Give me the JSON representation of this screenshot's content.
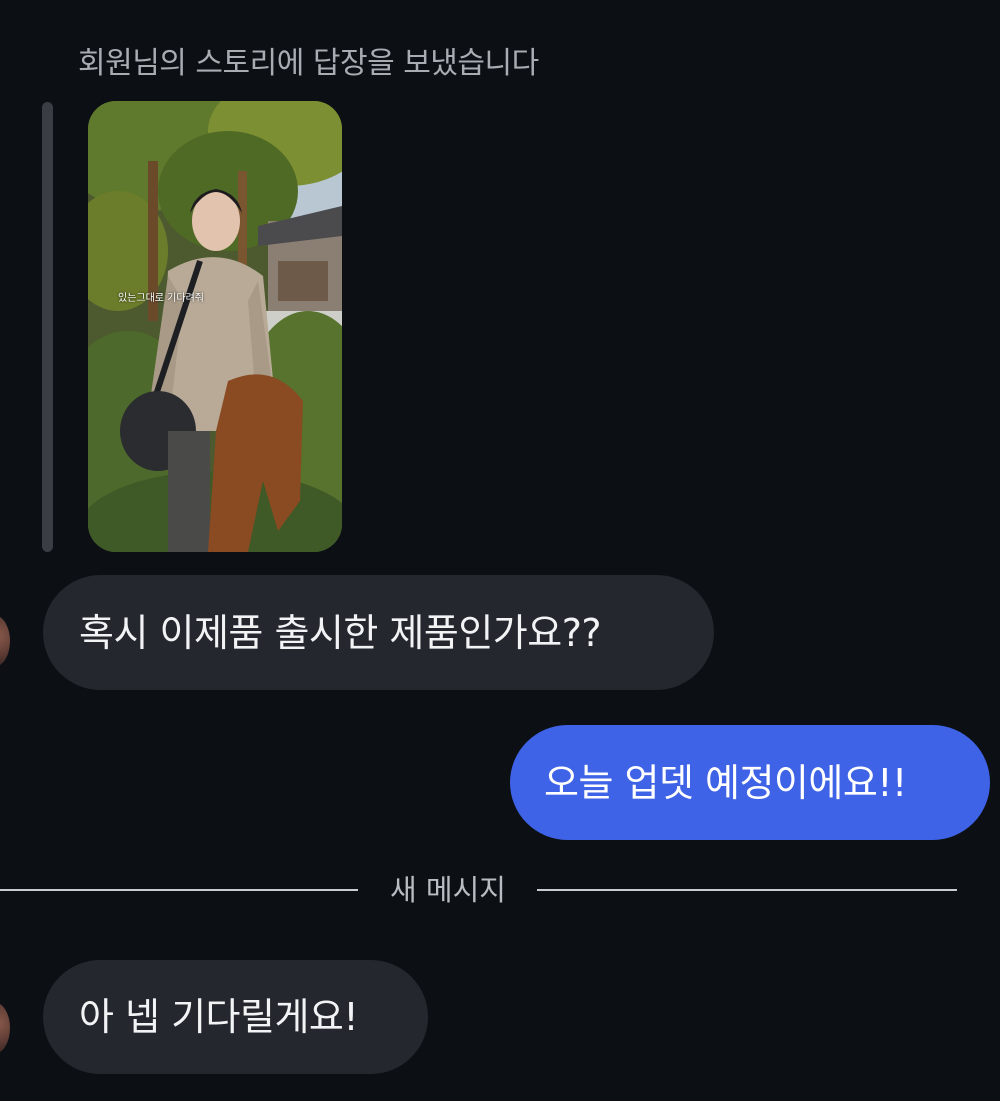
{
  "reply_context": "회원님의 스토리에 답장을 보냈습니다",
  "story": {
    "overlay_text": "있는그대로 기다려줘",
    "alt": "story-photo"
  },
  "messages": [
    {
      "direction": "incoming",
      "text": "혹시 이제품 출시한 제품인가요??"
    },
    {
      "direction": "outgoing",
      "text": "오늘 업뎃 예정이에요!!"
    },
    {
      "direction": "incoming",
      "text": "아 넵 기다릴게요!"
    }
  ],
  "new_messages_divider": "새 메시지",
  "colors": {
    "background": "#0c0f14",
    "incoming_bubble": "#24272d",
    "outgoing_bubble": "#3f63e6",
    "muted_text": "#a8acb3"
  }
}
